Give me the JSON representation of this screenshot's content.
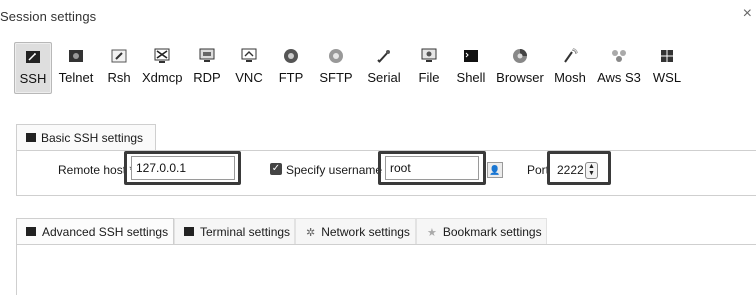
{
  "window": {
    "title": "Session settings",
    "close_glyph": "×"
  },
  "session_types": [
    {
      "label": "SSH",
      "icon": "ssh-icon",
      "selected": true
    },
    {
      "label": "Telnet",
      "icon": "telnet-icon"
    },
    {
      "label": "Rsh",
      "icon": "rsh-icon"
    },
    {
      "label": "Xdmcp",
      "icon": "xdmcp-icon"
    },
    {
      "label": "RDP",
      "icon": "rdp-icon"
    },
    {
      "label": "VNC",
      "icon": "vnc-icon"
    },
    {
      "label": "FTP",
      "icon": "ftp-icon"
    },
    {
      "label": "SFTP",
      "icon": "sftp-icon"
    },
    {
      "label": "Serial",
      "icon": "serial-icon"
    },
    {
      "label": "File",
      "icon": "file-icon"
    },
    {
      "label": "Shell",
      "icon": "shell-icon"
    },
    {
      "label": "Browser",
      "icon": "browser-icon"
    },
    {
      "label": "Mosh",
      "icon": "mosh-icon"
    },
    {
      "label": "Aws S3",
      "icon": "aws-s3-icon"
    },
    {
      "label": "WSL",
      "icon": "wsl-icon"
    }
  ],
  "basic_tab": {
    "label": "Basic SSH settings"
  },
  "basic": {
    "remote_host_label": "Remote host *",
    "remote_host_value": "127.0.0.1",
    "specify_username_label": "Specify username",
    "specify_username_checked": true,
    "username_value": "root",
    "port_label": "Port",
    "port_value": "2222"
  },
  "advanced_tabs": [
    {
      "label": "Advanced SSH settings",
      "icon": "terminal-icon"
    },
    {
      "label": "Terminal settings",
      "icon": "terminal-settings-icon"
    },
    {
      "label": "Network settings",
      "icon": "network-icon"
    },
    {
      "label": "Bookmark settings",
      "icon": "star-icon"
    }
  ],
  "colors": {
    "highlight_border": "#3a3a3a",
    "selected_tab_bg": "#dedede"
  }
}
